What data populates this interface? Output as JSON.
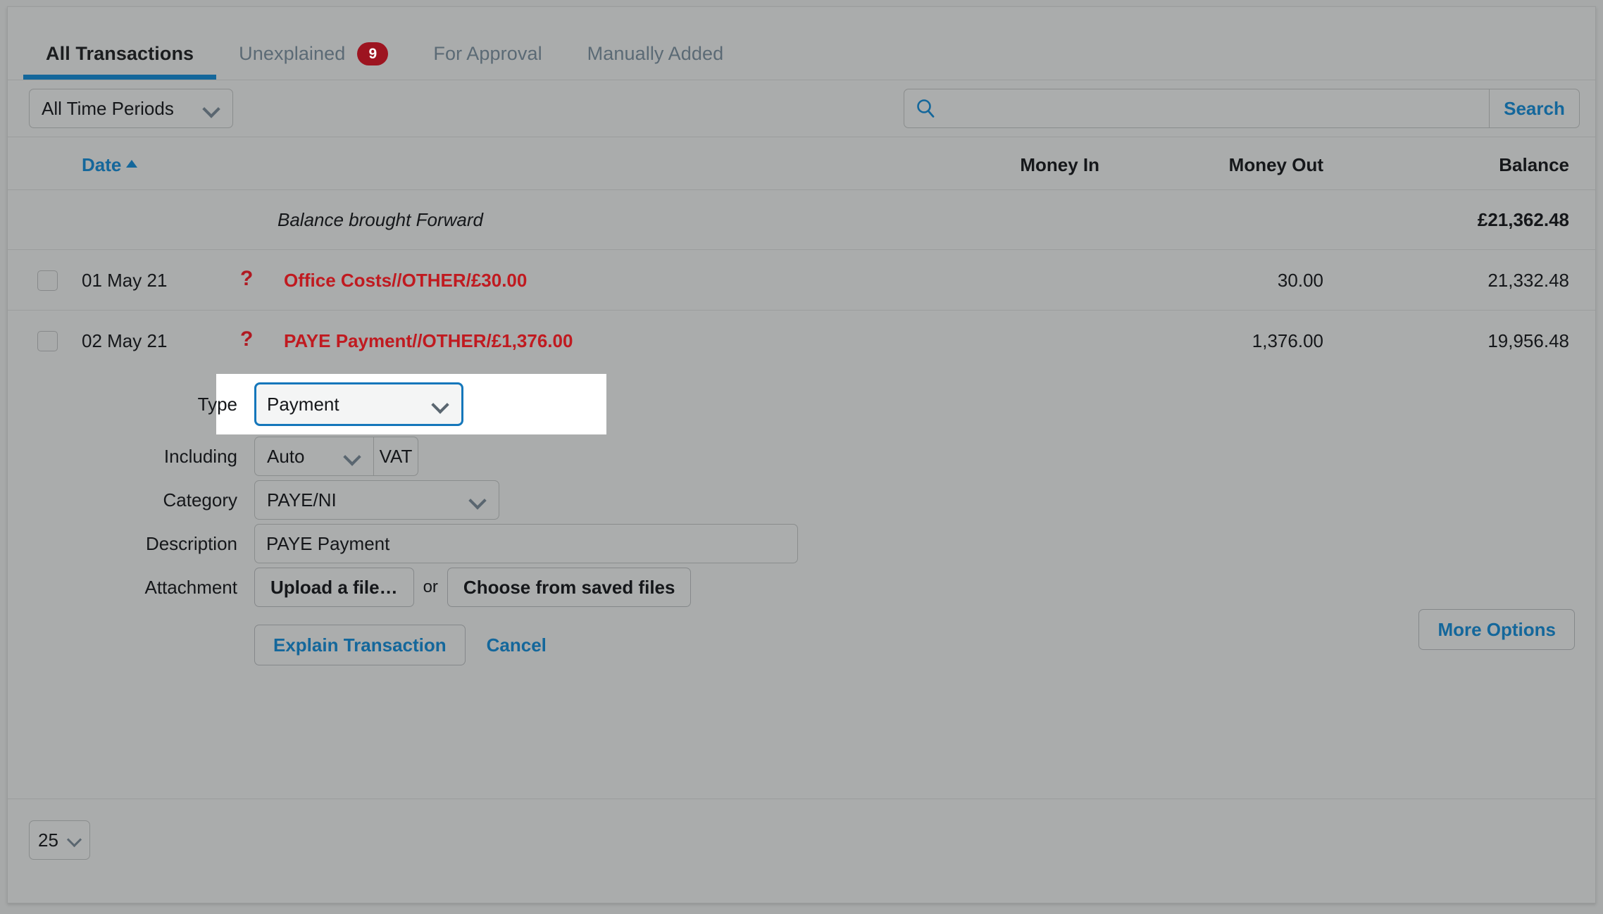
{
  "tabs": [
    {
      "label": "All Transactions",
      "active": true,
      "badge": null
    },
    {
      "label": "Unexplained",
      "active": false,
      "badge": "9"
    },
    {
      "label": "For Approval",
      "active": false,
      "badge": null
    },
    {
      "label": "Manually Added",
      "active": false,
      "badge": null
    }
  ],
  "filter": {
    "period_value": "All Time Periods",
    "search_value": "",
    "search_placeholder": "",
    "search_button": "Search",
    "search_icon": "search-icon"
  },
  "table": {
    "headers": {
      "date": "Date",
      "date_sort": "ascending",
      "money_in": "Money In",
      "money_out": "Money Out",
      "balance": "Balance"
    },
    "brought_forward": {
      "label": "Balance brought Forward",
      "balance": "£21,362.48"
    },
    "rows": [
      {
        "date": "01 May 21",
        "flag_icon": "question-mark-icon",
        "flag": "?",
        "description": "Office Costs//OTHER/£30.00",
        "money_in": "",
        "money_out": "30.00",
        "balance": "21,332.48"
      },
      {
        "date": "02 May 21",
        "flag_icon": "question-mark-icon",
        "flag": "?",
        "description": "PAYE Payment//OTHER/£1,376.00",
        "money_in": "",
        "money_out": "1,376.00",
        "balance": "19,956.48"
      }
    ]
  },
  "form": {
    "type": {
      "label": "Type",
      "value": "Payment"
    },
    "including": {
      "label": "Including",
      "value": "Auto",
      "suffix": "VAT"
    },
    "category": {
      "label": "Category",
      "value": "PAYE/NI"
    },
    "description": {
      "label": "Description",
      "value": "PAYE Payment",
      "placeholder": ""
    },
    "attachment": {
      "label": "Attachment",
      "upload_button": "Upload a file…",
      "or": "or",
      "choose_button": "Choose from saved files"
    },
    "actions": {
      "submit": "Explain Transaction",
      "cancel": "Cancel",
      "more_options": "More Options"
    }
  },
  "footer": {
    "page_size": "25"
  },
  "colors": {
    "accent_blue": "#14679b",
    "danger_red": "#c01a20",
    "badge_red": "#9d1420",
    "focus_blue": "#1577bb",
    "surface": "#aaacac"
  }
}
